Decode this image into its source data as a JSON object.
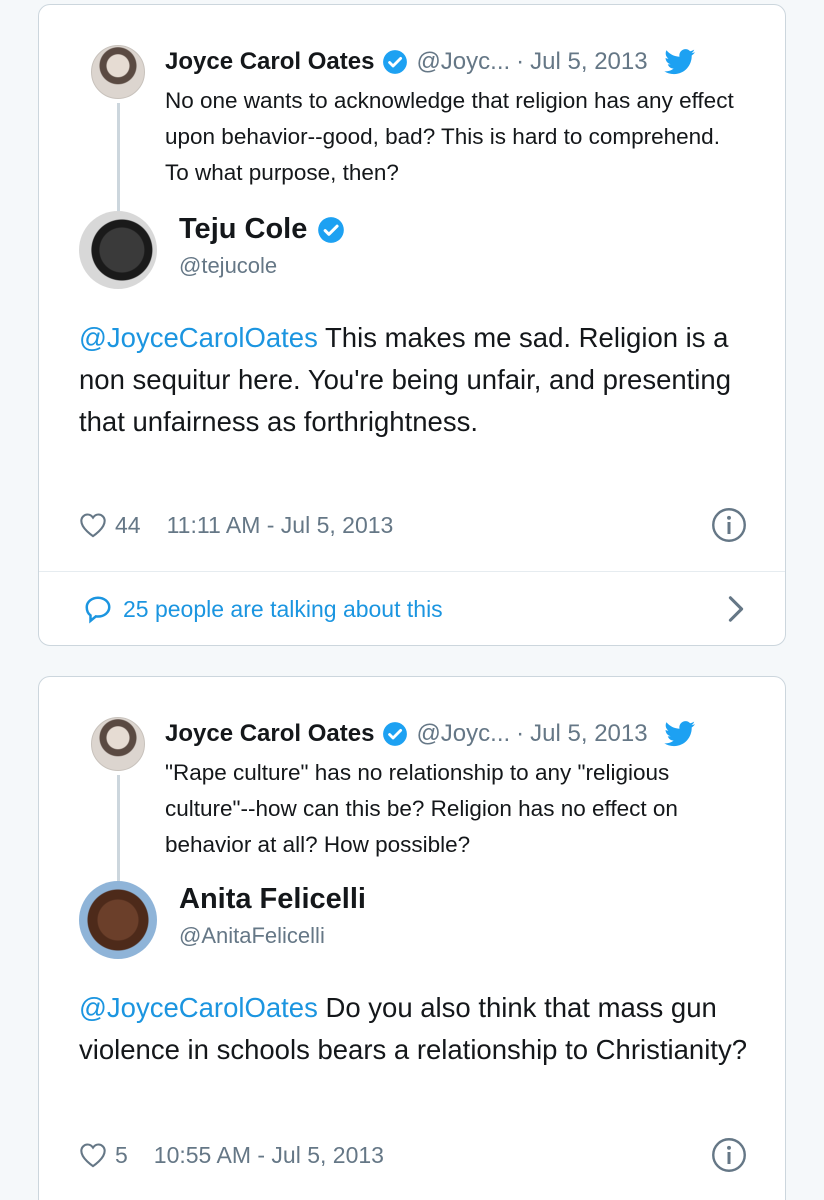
{
  "tweets": [
    {
      "parent": {
        "name": "Joyce Carol Oates",
        "handle": "@Joyc...",
        "date": "Jul 5, 2013",
        "text": "No one wants to acknowledge that religion has any effect upon behavior--good, bad?  This is hard to comprehend.  To what purpose, then?"
      },
      "author": {
        "name": "Teju Cole",
        "handle": "@tejucole",
        "verified": true
      },
      "mention": "@JoyceCarolOates",
      "body": " This makes me sad. Religion is a non sequitur here. You're being unfair, and presenting that unfairness as forthrightness.",
      "likes": "44",
      "timestamp": "11:11 AM - Jul 5, 2013",
      "talking": "25 people are talking about this"
    },
    {
      "parent": {
        "name": "Joyce Carol Oates",
        "handle": "@Joyc...",
        "date": "Jul 5, 2013",
        "text": "\"Rape culture\" has no relationship to any \"religious culture\"--how can this be? Religion has no effect on behavior at all?  How possible?"
      },
      "author": {
        "name": "Anita Felicelli",
        "handle": "@AnitaFelicelli",
        "verified": false
      },
      "mention": "@JoyceCarolOates",
      "body": " Do you also think that mass gun violence in schools bears a relationship to Christianity?",
      "likes": "5",
      "timestamp": "10:55 AM - Jul 5, 2013"
    }
  ],
  "colors": {
    "link": "#1b95e0",
    "secondary_text": "#657786",
    "verified_badge": "#1da1f2",
    "border": "#ccd6dd"
  },
  "icons": [
    "verified-badge-icon",
    "twitter-bird-icon",
    "heart-icon",
    "info-icon",
    "speech-bubble-icon",
    "chevron-right-icon"
  ]
}
